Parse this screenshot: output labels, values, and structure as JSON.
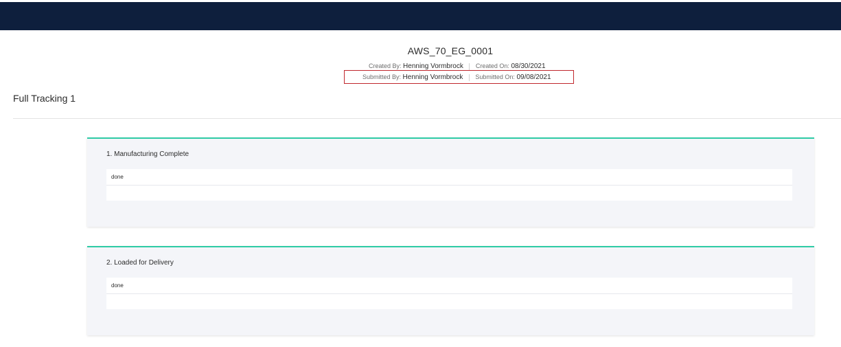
{
  "document": {
    "title": "AWS_70_EG_0001",
    "created_by_label": "Created By:",
    "created_by": "Henning Vormbrock",
    "created_on_label": "Created On:",
    "created_on": "08/30/2021",
    "submitted_by_label": "Submitted By:",
    "submitted_by": "Henning Vormbrock",
    "submitted_on_label": "Submitted On:",
    "submitted_on": "09/08/2021"
  },
  "section": {
    "title": "Full Tracking 1"
  },
  "steps": [
    {
      "title": "1. Manufacturing Complete",
      "answer": "done"
    },
    {
      "title": "2. Loaded for Delivery",
      "answer": "done"
    }
  ],
  "colors": {
    "topbar": "#0e1f3d",
    "card_accent": "#2ecba5",
    "highlight": "#c0262c"
  }
}
